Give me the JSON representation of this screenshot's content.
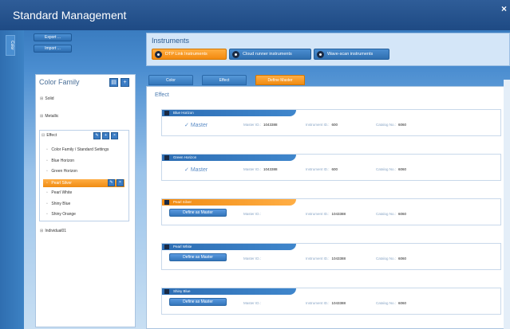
{
  "window": {
    "title": "Standard Management",
    "close_label": "×"
  },
  "left_strip": {
    "tab_label": "Color"
  },
  "side_buttons": {
    "export_label": "Export ...",
    "import_label": "Import ..."
  },
  "instruments": {
    "label": "Instruments",
    "buttons": [
      {
        "label": "DTP Link Instruments",
        "active": true
      },
      {
        "label": "Cloud runner instruments",
        "active": false
      },
      {
        "label": "Wave-scan instruments",
        "active": false
      }
    ]
  },
  "color_family": {
    "title": "Color Family",
    "items": [
      {
        "label": "Solid"
      },
      {
        "label": "Metallic"
      },
      {
        "label": "Effect"
      },
      {
        "label": "Individual01"
      }
    ],
    "effect_children": [
      {
        "label": "Color Family / Standard Settings"
      },
      {
        "label": "Blue Horizon"
      },
      {
        "label": "Green Horizon"
      },
      {
        "label": "Pearl Silver",
        "selected": true
      },
      {
        "label": "Pearl White"
      },
      {
        "label": "Shiny Blue"
      },
      {
        "label": "Shiny Orange"
      }
    ]
  },
  "tabs": [
    {
      "label": "Color",
      "active": false
    },
    {
      "label": "Effect",
      "active": false
    },
    {
      "label": "Define Master",
      "active": true
    }
  ],
  "effect_section": {
    "title": "Effect"
  },
  "field_labels": {
    "master_id": "Master ID.:",
    "instrument_id": "Instrument ID.:",
    "catalog_no": "Catalog No.:"
  },
  "cards": [
    {
      "name": "Blue Horizon",
      "state": "master",
      "master_text": "Master",
      "master_id": "1043388",
      "instrument_id": "600",
      "catalog_no": "6060"
    },
    {
      "name": "Green Horizon",
      "state": "master",
      "master_text": "Master",
      "master_id": "1043388",
      "instrument_id": "600",
      "catalog_no": "6060"
    },
    {
      "name": "Pearl Silver",
      "state": "define",
      "button_label": "Define as Master",
      "master_id": "",
      "instrument_id": "1043388",
      "catalog_no": "6060"
    },
    {
      "name": "Pearl White",
      "state": "define",
      "button_label": "Define as Master",
      "master_id": "",
      "instrument_id": "1043388",
      "catalog_no": "6060"
    },
    {
      "name": "Shiny Blue",
      "state": "define",
      "button_label": "Define as Master",
      "master_id": "",
      "instrument_id": "1043388",
      "catalog_no": "6060"
    }
  ],
  "colors": {
    "accent_blue": "#3b7cc4",
    "accent_orange": "#f28a10",
    "title_blue": "#1e4a84"
  }
}
